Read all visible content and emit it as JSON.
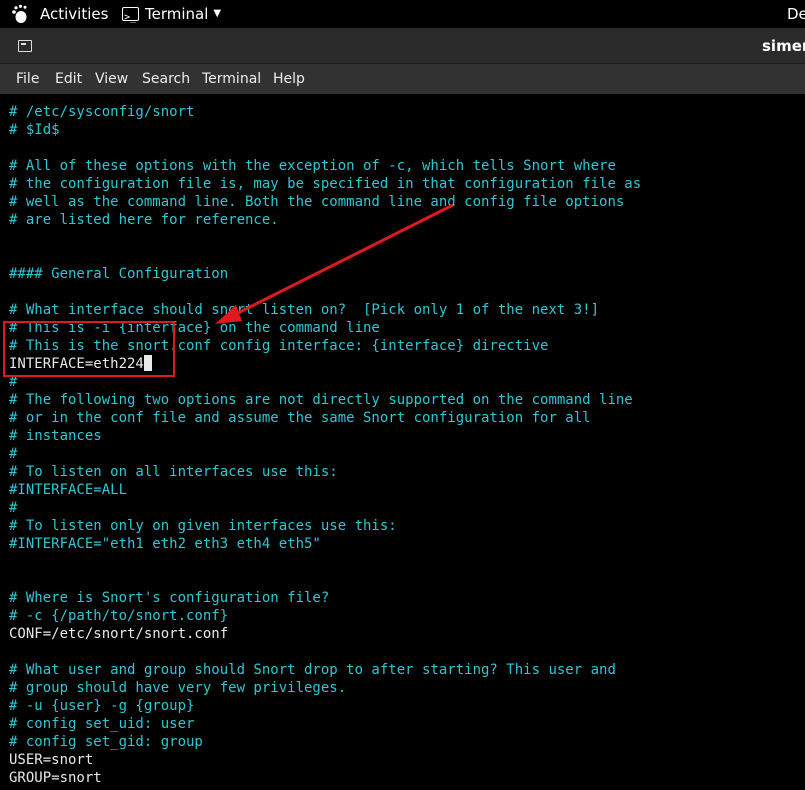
{
  "topbar": {
    "activities_label": "Activities",
    "app_menu_label": "Terminal",
    "clock_partial": "De"
  },
  "window": {
    "title": "simen",
    "menu": [
      "File",
      "Edit",
      "View",
      "Search",
      "Terminal",
      "Help"
    ]
  },
  "terminal": {
    "lines": [
      "# /etc/sysconfig/snort",
      "# $Id$",
      "",
      "# All of these options with the exception of -c, which tells Snort where",
      "# the configuration file is, may be specified in that configuration file as",
      "# well as the command line. Both the command line and config file options",
      "# are listed here for reference.",
      "",
      "",
      "#### General Configuration",
      "",
      "# What interface should snort listen on?  [Pick only 1 of the next 3!]",
      "# This is -i {interface} on the command line",
      "# This is the snort.conf config interface: {interface} directive",
      "INTERFACE=eth224",
      "#",
      "# The following two options are not directly supported on the command line",
      "# or in the conf file and assume the same Snort configuration for all",
      "# instances",
      "#",
      "# To listen on all interfaces use this:",
      "#INTERFACE=ALL",
      "#",
      "# To listen only on given interfaces use this:",
      "#INTERFACE=\"eth1 eth2 eth3 eth4 eth5\"",
      "",
      "",
      "# Where is Snort's configuration file?",
      "# -c {/path/to/snort.conf}",
      "CONF=/etc/snort/snort.conf",
      "",
      "# What user and group should Snort drop to after starting? This user and",
      "# group should have very few privileges.",
      "# -u {user} -g {group}",
      "# config set_uid: user",
      "# config set_gid: group",
      "USER=snort",
      "GROUP=snort"
    ],
    "cursor_line_index": 14
  },
  "colors": {
    "comment": "#2ec7d4",
    "plain_text": "#e8e8e8",
    "background": "#000000",
    "annotation": "#e0191e"
  },
  "icons": {
    "activities": "gnome-foot-icon",
    "app_menu": "terminal-icon",
    "tab": "terminal-tab-icon"
  }
}
